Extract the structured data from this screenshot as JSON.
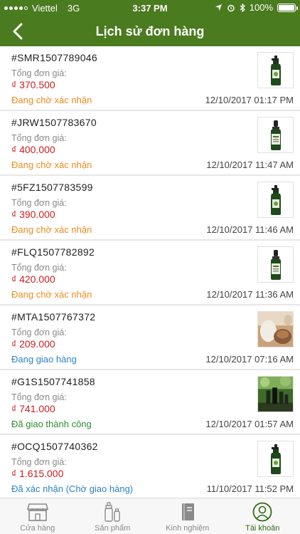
{
  "status_bar": {
    "carrier": "Viettel",
    "network": "3G",
    "time": "3:37 PM",
    "battery": "100%",
    "battery_level": 1.0
  },
  "header": {
    "title": "Lịch sử đơn hàng"
  },
  "colors": {
    "brand_green": "#4a7b1f",
    "price_red": "#cc1f1f",
    "status_pending": "#f08a1c",
    "status_shipping": "#2a84c9",
    "status_done": "#2f8c2f"
  },
  "orders": [
    {
      "id": "#SMR1507789046",
      "total_label": "Tổng đơn giá:",
      "total": "₫ 370.500",
      "status": "Đang chờ xác nhận",
      "status_type": "pending",
      "date": "12/10/2017 01:17 PM",
      "thumb": "bottle-pump-icon"
    },
    {
      "id": "#JRW1507783670",
      "total_label": "Tổng đơn giá:",
      "total": "₫ 400.000",
      "status": "Đang chờ xác nhận",
      "status_type": "pending",
      "date": "12/10/2017 11:47 AM",
      "thumb": "dropper-bottle-icon"
    },
    {
      "id": "#5FZ1507783599",
      "total_label": "Tổng đơn giá:",
      "total": "₫ 390.000",
      "status": "Đang chờ xác nhận",
      "status_type": "pending",
      "date": "12/10/2017 11:46 AM",
      "thumb": "bottle-pump-icon"
    },
    {
      "id": "#FLQ1507782892",
      "total_label": "Tổng đơn giá:",
      "total": "₫ 420.000",
      "status": "Đang chờ xác nhận",
      "status_type": "pending",
      "date": "12/10/2017 11:36 AM",
      "thumb": "dropper-bottle-icon"
    },
    {
      "id": "#MTA1507767372",
      "total_label": "Tổng đơn giá:",
      "total": "₫ 209.000",
      "status": "Đang giao hàng",
      "status_type": "shipping",
      "date": "12/10/2017 07:16 AM",
      "thumb": "product-jar-photo"
    },
    {
      "id": "#G1S1507741858",
      "total_label": "Tổng đơn giá:",
      "total": "₫ 741.000",
      "status": "Đã giao thành công",
      "status_type": "done",
      "date": "12/10/2017 01:57 AM",
      "thumb": "product-set-photo"
    },
    {
      "id": "#OCQ1507740362",
      "total_label": "Tổng đơn giá:",
      "total": "₫ 1.615.000",
      "status": "Đã xác nhận (Chờ giao hàng)",
      "status_type": "shipping",
      "date": "11/10/2017 11:52 PM",
      "thumb": "bottle-pump-icon"
    }
  ],
  "tabs": [
    {
      "label": "Cửa hàng",
      "icon": "store-icon",
      "active": false
    },
    {
      "label": "Sản phẩm",
      "icon": "products-icon",
      "active": false
    },
    {
      "label": "Kinh nghiệm",
      "icon": "book-icon",
      "active": false
    },
    {
      "label": "Tài khoản",
      "icon": "account-icon",
      "active": true
    }
  ]
}
